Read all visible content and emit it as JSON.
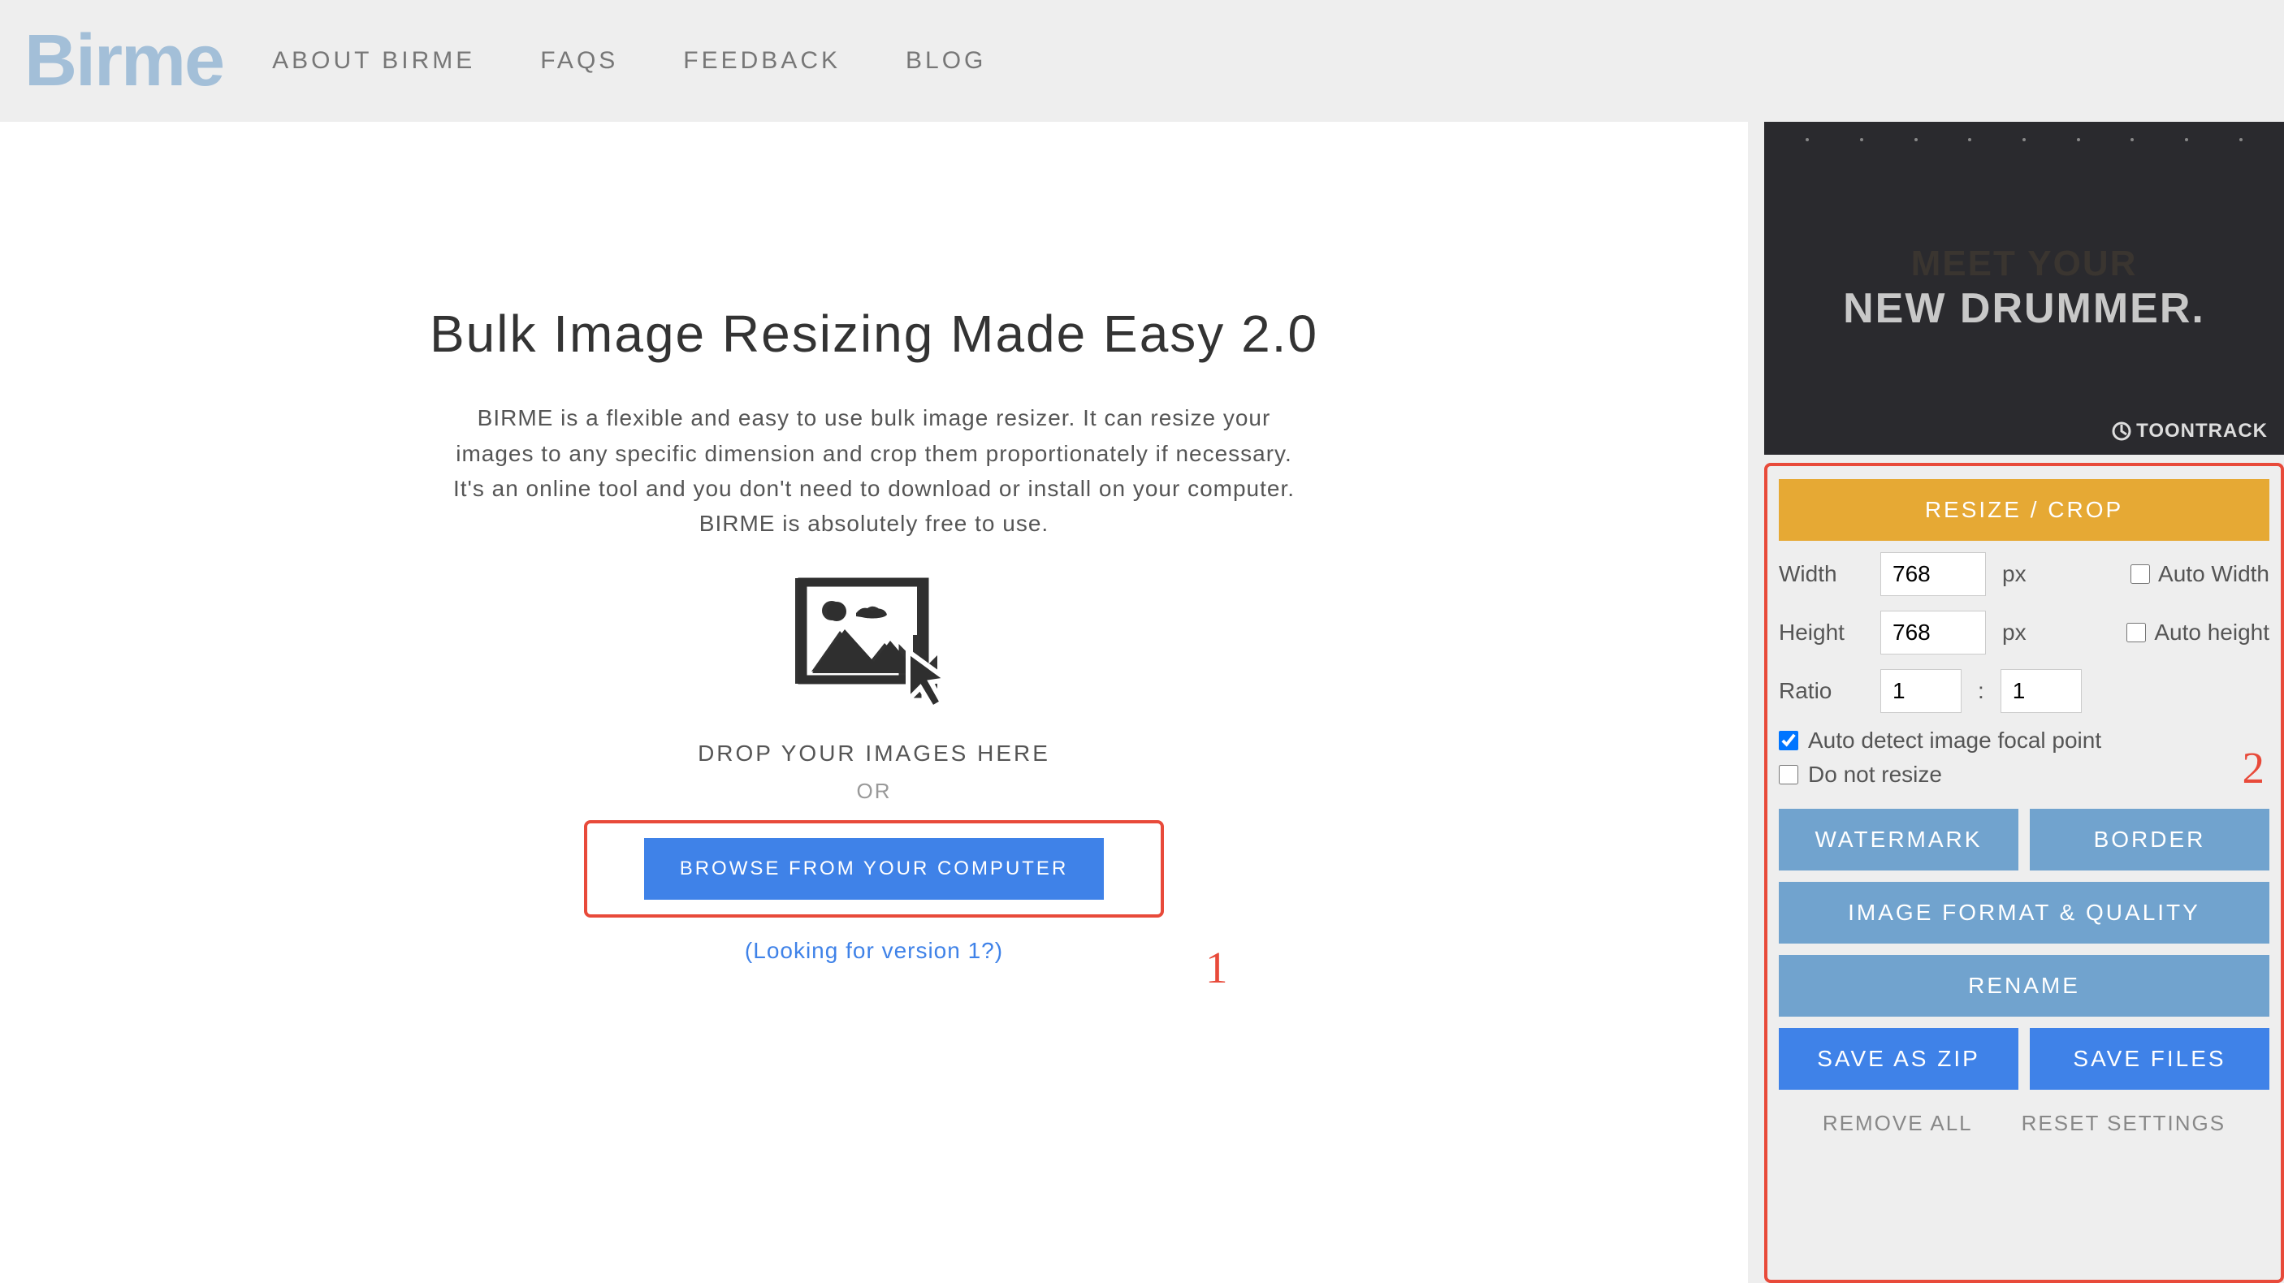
{
  "logo": "Birme",
  "nav": [
    "ABOUT BIRME",
    "FAQS",
    "FEEDBACK",
    "BLOG"
  ],
  "main": {
    "title": "Bulk Image Resizing Made Easy 2.0",
    "description": "BIRME is a flexible and easy to use bulk image resizer. It can resize your images to any specific dimension and crop them proportionately if necessary. It's an online tool and you don't need to download or install on your computer. BIRME is absolutely free to use.",
    "drop_text": "DROP YOUR IMAGES HERE",
    "or_text": "OR",
    "browse_label": "BROWSE FROM YOUR COMPUTER",
    "version_link": "(Looking for version 1?)"
  },
  "annotations": {
    "one": "1",
    "two": "2"
  },
  "ad": {
    "line1": "MEET YOUR",
    "line2": "NEW DRUMMER.",
    "brand": "TOONTRACK"
  },
  "panel": {
    "resize_crop": "RESIZE / CROP",
    "width_label": "Width",
    "width_value": "768",
    "height_label": "Height",
    "height_value": "768",
    "px": "px",
    "auto_width": "Auto Width",
    "auto_height": "Auto height",
    "ratio_label": "Ratio",
    "ratio_a": "1",
    "ratio_b": "1",
    "ratio_colon": ":",
    "auto_focal": "Auto detect image focal point",
    "auto_focal_checked": true,
    "do_not_resize": "Do not resize",
    "watermark": "WATERMARK",
    "border": "BORDER",
    "image_format": "IMAGE FORMAT & QUALITY",
    "rename": "RENAME",
    "save_zip": "SAVE AS ZIP",
    "save_files": "SAVE FILES",
    "remove_all": "REMOVE ALL",
    "reset_settings": "RESET SETTINGS"
  }
}
